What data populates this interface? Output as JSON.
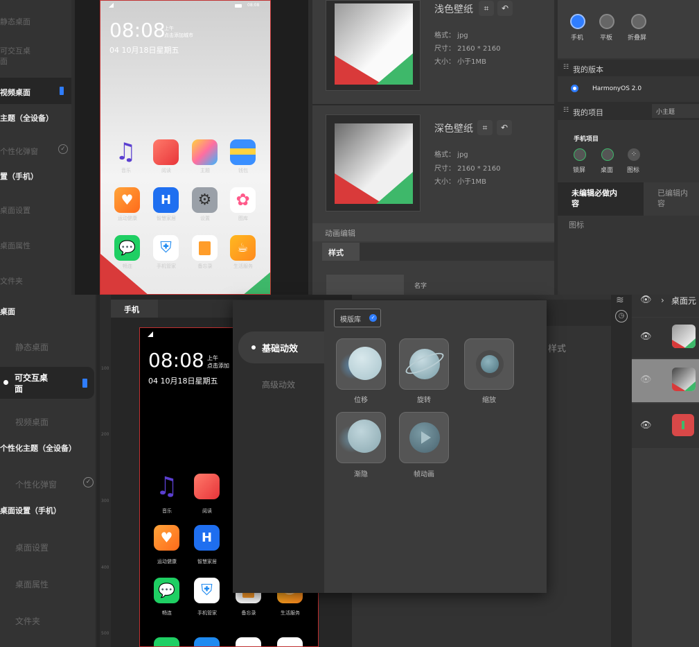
{
  "top_nav": {
    "items": [
      "静态桌面",
      "可交互桌\n面",
      "视频桌面",
      "主题（全设备）",
      "个性化弹窗",
      "置（手机）",
      "桌面设置",
      "桌面属性",
      "文件夹"
    ]
  },
  "phone_top": {
    "time": "08:08",
    "ampm": "上午",
    "city_hint": "点击添加城市",
    "date": "04 10月18日星期五",
    "status_time": "08:08",
    "app_labels": [
      "音乐",
      "阅读",
      "主题",
      "钱包",
      "运动健康",
      "智慧家居",
      "设置",
      "图库",
      "畅连",
      "手机管家",
      "备忘录",
      "生活服务"
    ]
  },
  "wallpapers": [
    {
      "title": "浅色壁纸",
      "format": "格式： jpg",
      "size": "尺寸： 2160 * 2160",
      "filesize": "大小： 小于1MB"
    },
    {
      "title": "深色壁纸",
      "format": "格式： jpg",
      "size": "尺寸： 2160 * 2160",
      "filesize": "大小： 小于1MB"
    }
  ],
  "anim_edit": {
    "section": "动画编辑",
    "tab": "样式",
    "name_label": "名字"
  },
  "right_panel": {
    "devices": [
      "手机",
      "平板",
      "折叠屏"
    ],
    "version_header": "我的版本",
    "version": "HarmonyOS 2.0",
    "project_header": "我的项目",
    "project_type": "小主题",
    "project_name": "手机项目",
    "project_items": [
      "锁屏",
      "桌面",
      "图标"
    ],
    "tab_unedited": "未编辑必做内\n容",
    "tab_edited": "已编辑内\n容",
    "icon_label": "图标"
  },
  "bottom_nav": {
    "top_cut": "桌面",
    "items": [
      "静态桌面",
      "可交互桌\n面",
      "视频桌面",
      "个性化主题（全设备）",
      "个性化弹窗",
      "桌面设置（手机）",
      "桌面设置",
      "桌面属性",
      "文件夹"
    ]
  },
  "canvas": {
    "tab": "手机",
    "ruler_marks": [
      "100",
      "200",
      "300",
      "400",
      "500"
    ],
    "time": "08:08",
    "ampm": "上午",
    "city_hint": "点击添加",
    "date": "04 10月18日星期五",
    "app_labels": [
      "音乐",
      "阅读",
      "运动健康",
      "智慧家居",
      "畅连",
      "手机管家",
      "备忘录",
      "生活服务"
    ]
  },
  "effects_modal": {
    "library_label": "模版库",
    "menu": [
      "基础动效",
      "高级动效"
    ],
    "effects": [
      "位移",
      "旋转",
      "缩放",
      "渐隐",
      "帧动画"
    ]
  },
  "behind_modal": {
    "style_label": "样式"
  },
  "layers": {
    "breadcrumb": "桌面元"
  },
  "colors": {
    "accent": "#2f7dff",
    "dark_bg": "#2a2a2a",
    "panel": "#3a3a3a"
  }
}
